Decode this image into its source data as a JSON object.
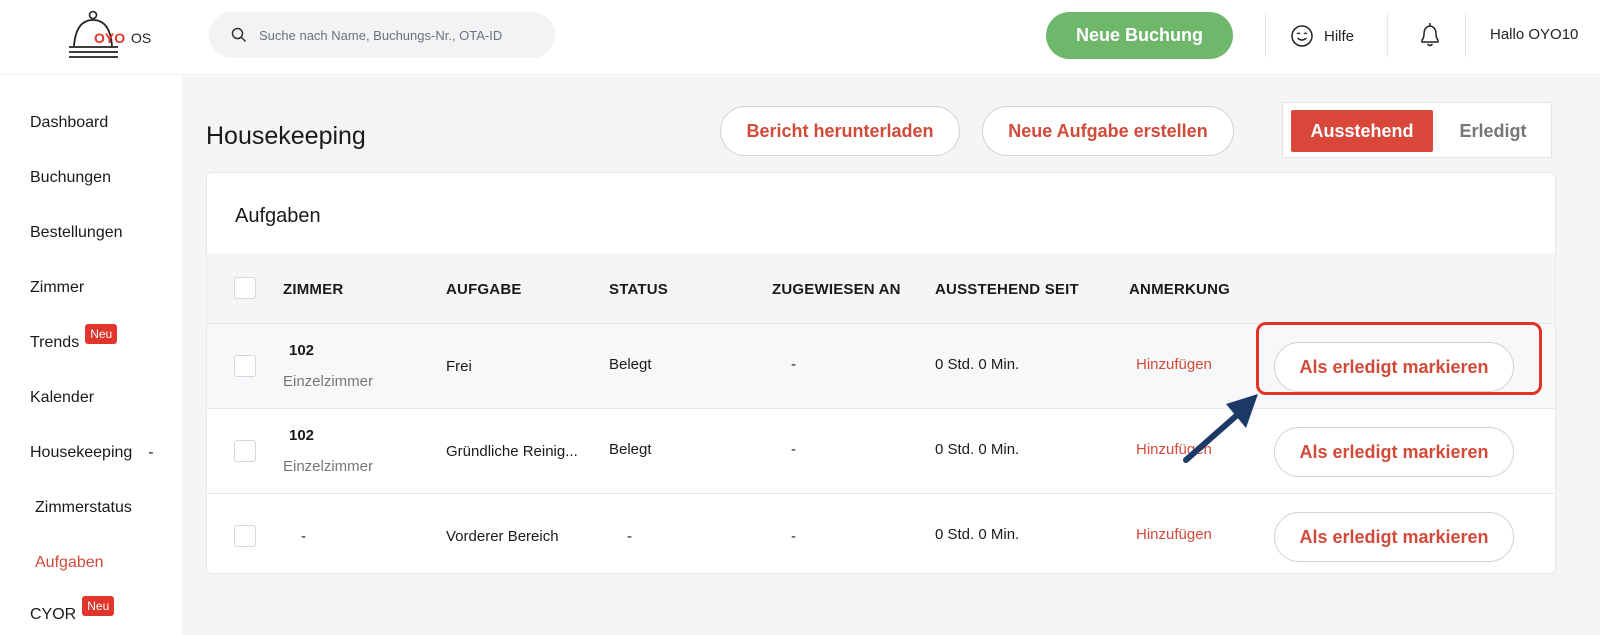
{
  "header": {
    "logo_text_a": "OYO",
    "logo_text_b": "OS",
    "search_placeholder": "Suche nach Name, Buchungs-Nr., OTA-ID",
    "new_booking_label": "Neue Buchung",
    "help_label": "Hilfe",
    "greeting": "Hallo OYO10",
    "icons": [
      "search-icon",
      "help-face-icon",
      "bell-icon"
    ]
  },
  "sidebar": {
    "items": [
      {
        "label": "Dashboard"
      },
      {
        "label": "Buchungen"
      },
      {
        "label": "Bestellungen"
      },
      {
        "label": "Zimmer"
      },
      {
        "label": "Trends",
        "badge": "Neu"
      },
      {
        "label": "Kalender"
      },
      {
        "label": "Housekeeping",
        "suffix": "-"
      },
      {
        "label": "Zimmerstatus"
      },
      {
        "label": "Aufgaben",
        "active": true
      },
      {
        "label": "CYOR",
        "badge": "Neu"
      }
    ]
  },
  "page": {
    "title": "Housekeeping",
    "download_report_label": "Bericht herunterladen",
    "new_task_label": "Neue Aufgabe erstellen",
    "filter": {
      "pending": "Ausstehend",
      "done": "Erledigt",
      "selected": "Ausstehend"
    }
  },
  "tasks": {
    "title": "Aufgaben",
    "columns": [
      "ZIMMER",
      "AUFGABE",
      "STATUS",
      "ZUGEWIESEN AN",
      "AUSSTEHEND SEIT",
      "ANMERKUNG"
    ],
    "rows": [
      {
        "room": "102",
        "room_type": "Einzelzimmer",
        "task": "Frei",
        "status": "Belegt",
        "assigned": "-",
        "pending_since": "0 Std. 0 Min.",
        "note": "Hinzufügen",
        "action": "Als erledigt markieren"
      },
      {
        "room": "102",
        "room_type": "Einzelzimmer",
        "task": "Gründliche Reinig...",
        "status": "Belegt",
        "assigned": "-",
        "pending_since": "0 Std. 0 Min.",
        "note": "Hinzufügen",
        "action": "Als erledigt markieren"
      },
      {
        "room": "-",
        "room_type": "",
        "task": "Vorderer Bereich",
        "status": "-",
        "assigned": "-",
        "pending_since": "0 Std. 0 Min.",
        "note": "Hinzufügen",
        "action": "Als erledigt markieren"
      }
    ]
  },
  "colors": {
    "brand_red": "#d24a3a",
    "green": "#6eb76b",
    "annotation_red": "#e53226",
    "annotation_arrow": "#1d3a66"
  }
}
